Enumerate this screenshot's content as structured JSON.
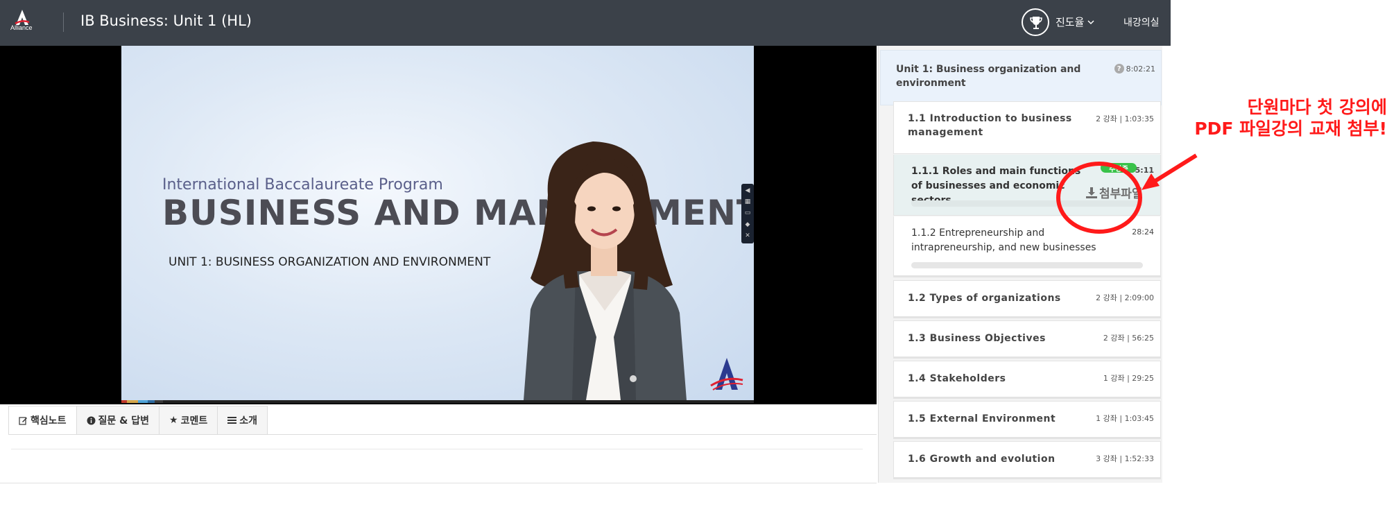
{
  "header": {
    "logo_text": "Alliance",
    "course_title": "IB Business: Unit 1 (HL)",
    "progress_label": "진도율",
    "my_classroom": "내강의실"
  },
  "video": {
    "slide_subtitle": "International Baccalaureate Program",
    "slide_title": "BUSINESS AND MANAGEMENT",
    "slide_unit": "UNIT 1: BUSINESS ORGANIZATION AND ENVIRONMENT"
  },
  "tabs": [
    {
      "label": "핵심노트",
      "icon": "edit-icon"
    },
    {
      "label": "질문 & 답변",
      "icon": "info-icon"
    },
    {
      "label": "코멘트",
      "icon": "star-icon"
    },
    {
      "label": "소개",
      "icon": "list-icon"
    }
  ],
  "sidebar": {
    "unit": {
      "title": "Unit 1: Business organization and environment",
      "time": "8:02:21",
      "help": "?"
    },
    "sections": [
      {
        "title": "1.1 Introduction to business management",
        "meta": "2 강좌 | 1:03:35"
      },
      {
        "title": "1.2 Types of organizations",
        "meta": "2 강좌 | 2:09:00"
      },
      {
        "title": "1.3 Business Objectives",
        "meta": "2 강좌 | 56:25"
      },
      {
        "title": "1.4 Stakeholders",
        "meta": "1 강좌 | 29:25"
      },
      {
        "title": "1.5 External Environment",
        "meta": "1 강좌 | 1:03:45"
      },
      {
        "title": "1.6 Growth and evolution",
        "meta": "3 강좌 | 1:52:33"
      }
    ],
    "lessons": [
      {
        "title": "1.1.1 Roles and main functions of businesses and economic sectors",
        "time": "35:11",
        "badge": "수강중",
        "attachment": "첨부파일",
        "progress": 0
      },
      {
        "title": "1.1.2 Entrepreneurship and intrapreneurship, and new businesses",
        "time": "28:24",
        "progress": 0
      }
    ]
  },
  "annotation": {
    "line1": "단원마다 첫 강의에",
    "line2": "PDF 파일강의 교재 첨부!",
    "color": "#ff1a1a"
  }
}
